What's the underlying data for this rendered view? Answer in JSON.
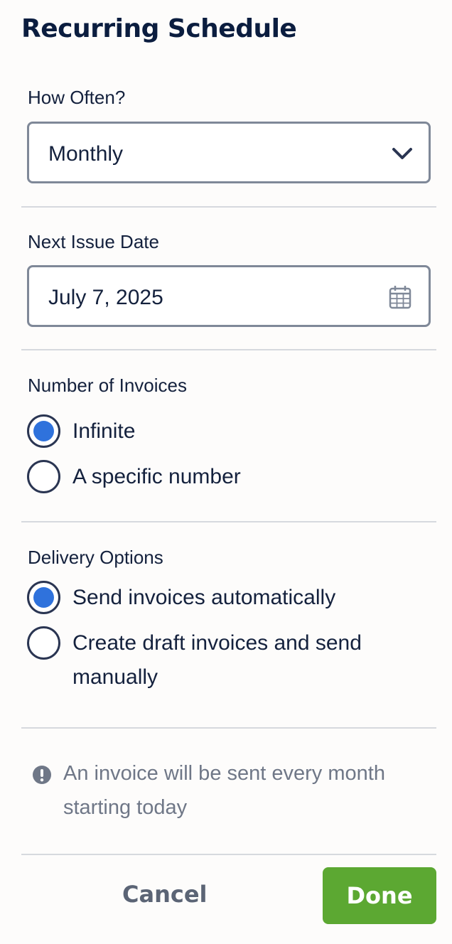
{
  "header": {
    "title": "Recurring Schedule"
  },
  "frequency": {
    "label": "How Often?",
    "value": "Monthly",
    "icon": "chevron-down-icon"
  },
  "next_issue": {
    "label": "Next Issue Date",
    "value": "July 7, 2025",
    "icon": "calendar-icon"
  },
  "number_of_invoices": {
    "label": "Number of Invoices",
    "options": [
      {
        "label": "Infinite",
        "selected": true
      },
      {
        "label": "A specific number",
        "selected": false
      }
    ]
  },
  "delivery": {
    "label": "Delivery Options",
    "options": [
      {
        "label": "Send invoices automatically",
        "selected": true
      },
      {
        "label": "Create draft invoices and send manually",
        "selected": false
      }
    ]
  },
  "info": {
    "icon": "exclamation-circle-icon",
    "text": "An invoice will be sent every month starting today"
  },
  "footer": {
    "cancel_label": "Cancel",
    "done_label": "Done"
  },
  "colors": {
    "accent": "#2f72dc",
    "primary_button": "#5ca832",
    "text_dark": "#0b1d3f",
    "text_muted": "#6f7787"
  }
}
